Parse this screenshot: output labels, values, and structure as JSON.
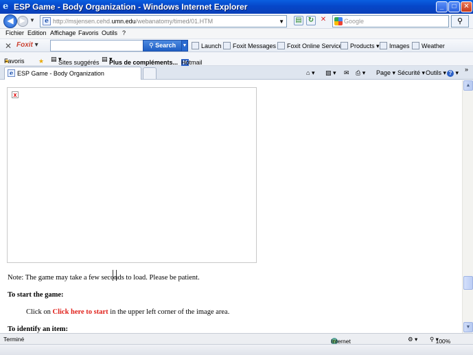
{
  "window": {
    "title": "ESP Game - Body Organization - Windows Internet Explorer",
    "minimize": "_",
    "maximize": "□",
    "close": "✕"
  },
  "address": {
    "url_prefix": "http://msjensen.cehd.",
    "url_domain": "umn.edu",
    "url_suffix": "/webanatomy/timed/01.HTM",
    "search_placeholder": "Google"
  },
  "menu": [
    "Fichier",
    "Edition",
    "Affichage",
    "Favoris",
    "Outils",
    "?"
  ],
  "foxit": {
    "brand": "Foxit",
    "search_label": "Search",
    "items": [
      "Launch",
      "Foxit Messages",
      "Foxit Online Services",
      "Products",
      "Images",
      "Weather"
    ]
  },
  "favorites": {
    "favoris": "Favoris",
    "suggested": "Sites suggérés",
    "more": "Plus de compléments...",
    "hotmail": "Hotmail"
  },
  "tab": {
    "label": "ESP Game - Body Organization"
  },
  "commands": {
    "page": "Page",
    "security": "Sécurité",
    "tools": "Outils"
  },
  "content": {
    "note": "Note: The game may take a few seconds to load. Please be patient.",
    "start_heading": "To start the game:",
    "click_prefix": "Click on",
    "click_link": "Click here to start",
    "click_suffix": "in the upper left corner of the image area.",
    "identify_heading": "To identify an item:"
  },
  "status": {
    "text": "Terminé",
    "zone": "Internet",
    "zoom": "100%"
  },
  "icons": [
    "ie-logo-icon",
    "back-icon",
    "forward-icon",
    "page-icon",
    "compat-icon",
    "refresh-icon",
    "stop-icon",
    "google-icon",
    "search-icon",
    "home-icon",
    "rss-icon",
    "mail-icon",
    "print-icon",
    "help-icon",
    "globe-icon",
    "broken-image-icon"
  ]
}
